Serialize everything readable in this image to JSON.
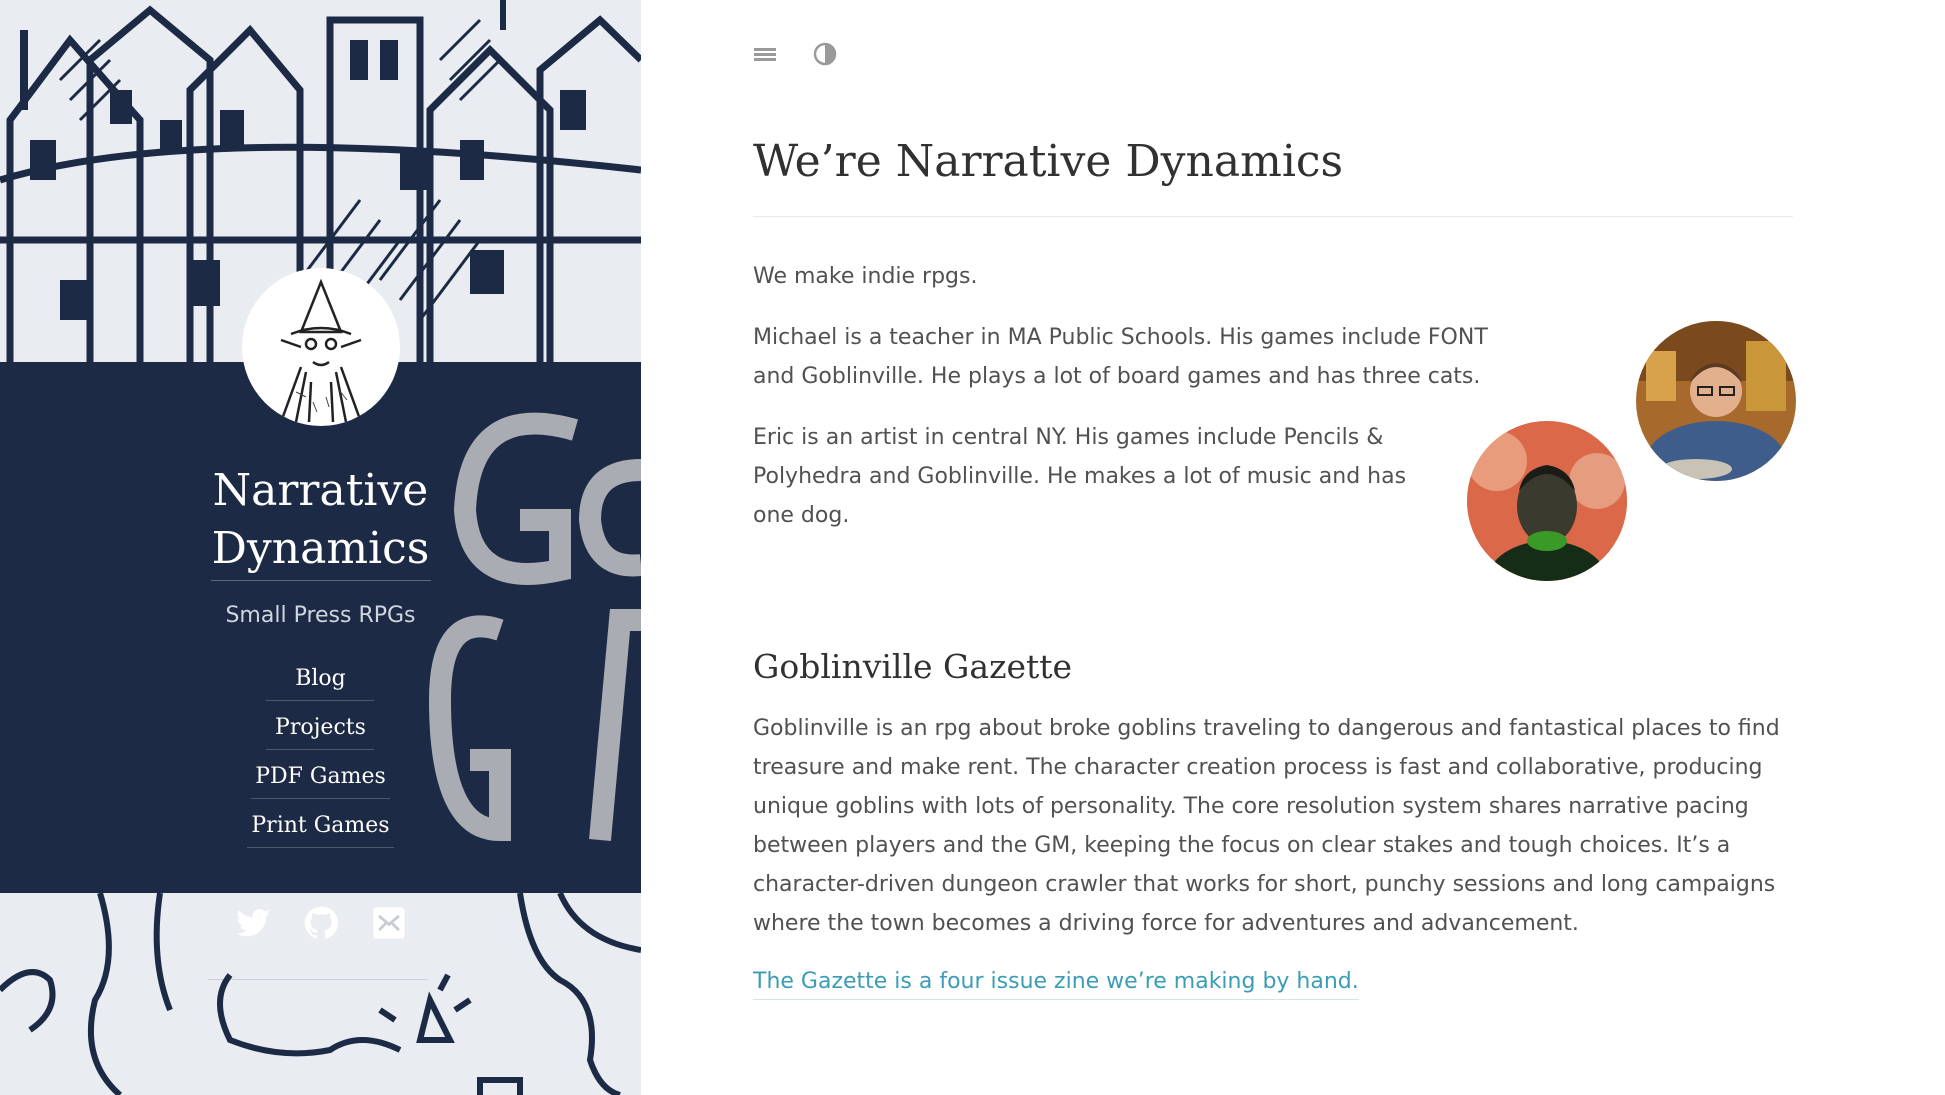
{
  "sidebar": {
    "title_line1": "Narrative",
    "title_line2": "Dynamics",
    "tagline": "Small Press RPGs",
    "nav": [
      {
        "label": "Blog"
      },
      {
        "label": "Projects"
      },
      {
        "label": "PDF Games"
      },
      {
        "label": "Print Games"
      }
    ],
    "social": [
      "twitter-icon",
      "github-icon",
      "email-icon"
    ]
  },
  "topbar": {
    "icons": [
      "menu-icon",
      "contrast-icon"
    ]
  },
  "main": {
    "title": "We’re Narrative Dynamics",
    "intro": "We make indie rpgs.",
    "michael": "Michael is a teacher in MA Public Schools. His games include FONT and Goblinville. He plays a lot of board games and has three cats.",
    "eric": "Eric is an artist in central NY. His games include Pencils & Polyhedra and Goblinville. He makes a lot of music and has one dog.",
    "section_title": "Goblinville Gazette",
    "section_body": "Goblinville is an rpg about broke goblins traveling to dangerous and fantastical places to find treasure and make rent. The character creation process is fast and collaborative, producing unique goblins with lots of personality. The core resolution system shares narrative pacing between players and the GM, keeping the focus on clear stakes and tough choices. It’s a character-driven dungeon crawler that works for short, punchy sessions and long campaigns where the town becomes a driving force for adventures and advancement.",
    "section_link": "The Gazette is a four issue zine we’re making by hand."
  },
  "colors": {
    "sidebar_bg": "#1c2a45",
    "link": "#3a9db5",
    "heading": "#313131",
    "body_text": "#515151"
  }
}
